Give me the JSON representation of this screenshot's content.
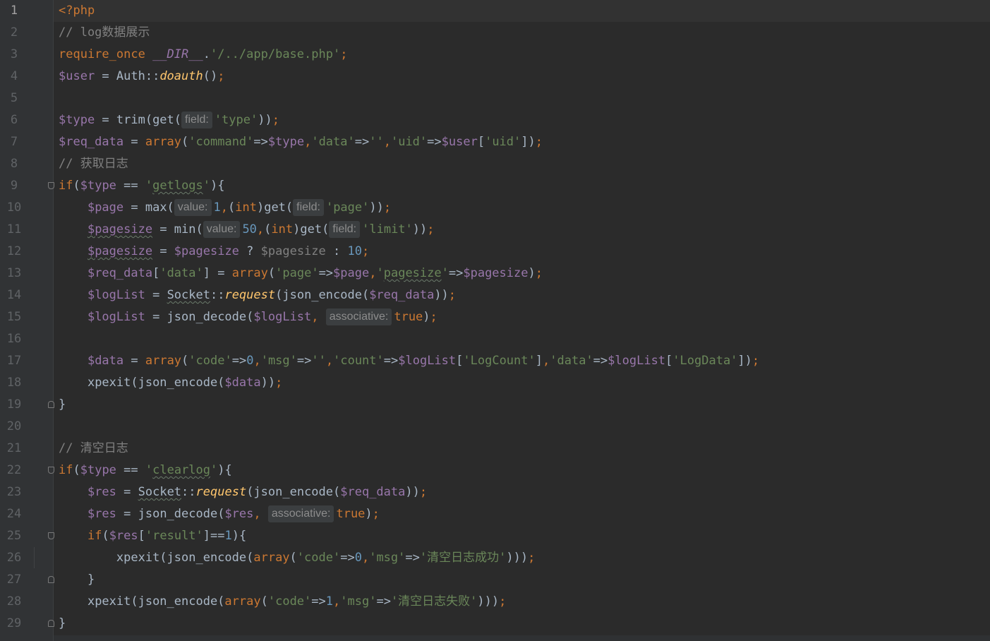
{
  "editor": {
    "current_line": 1,
    "line_numbers": [
      "1",
      "2",
      "3",
      "4",
      "5",
      "6",
      "7",
      "8",
      "9",
      "10",
      "11",
      "12",
      "13",
      "14",
      "15",
      "16",
      "17",
      "18",
      "19",
      "20",
      "21",
      "22",
      "23",
      "24",
      "25",
      "26",
      "27",
      "28",
      "29"
    ],
    "lines": [
      [
        {
          "t": "kw",
          "v": "<?php"
        }
      ],
      [
        {
          "t": "cmt",
          "v": "// log数据展示"
        }
      ],
      [
        {
          "t": "kw",
          "v": "require_once "
        },
        {
          "t": "const",
          "v": "__DIR__"
        },
        {
          "t": "op",
          "v": "."
        },
        {
          "t": "str",
          "v": "'/../app/base.php'"
        },
        {
          "t": "kw",
          "v": ";"
        }
      ],
      [
        {
          "t": "var",
          "v": "$user"
        },
        {
          "t": "op",
          "v": " = Auth::"
        },
        {
          "t": "fn",
          "v": "doauth"
        },
        {
          "t": "op",
          "v": "()"
        },
        {
          "t": "kw",
          "v": ";"
        }
      ],
      [],
      [
        {
          "t": "var",
          "v": "$type"
        },
        {
          "t": "op",
          "v": " = trim(get("
        },
        {
          "t": "hint",
          "v": "field:"
        },
        {
          "t": "str",
          "v": "'type'"
        },
        {
          "t": "op",
          "v": "))"
        },
        {
          "t": "kw",
          "v": ";"
        }
      ],
      [
        {
          "t": "var",
          "v": "$req_data"
        },
        {
          "t": "op",
          "v": " = "
        },
        {
          "t": "kw",
          "v": "array"
        },
        {
          "t": "op",
          "v": "("
        },
        {
          "t": "str",
          "v": "'command'"
        },
        {
          "t": "op",
          "v": "=>"
        },
        {
          "t": "var",
          "v": "$type"
        },
        {
          "t": "kw",
          "v": ","
        },
        {
          "t": "str",
          "v": "'data'"
        },
        {
          "t": "op",
          "v": "=>"
        },
        {
          "t": "str",
          "v": "''"
        },
        {
          "t": "kw",
          "v": ","
        },
        {
          "t": "str",
          "v": "'uid'"
        },
        {
          "t": "op",
          "v": "=>"
        },
        {
          "t": "var",
          "v": "$user"
        },
        {
          "t": "op",
          "v": "["
        },
        {
          "t": "str",
          "v": "'uid'"
        },
        {
          "t": "op",
          "v": "])"
        },
        {
          "t": "kw",
          "v": ";"
        }
      ],
      [
        {
          "t": "cmt",
          "v": "// 获取日志"
        }
      ],
      [
        {
          "t": "kw",
          "v": "if"
        },
        {
          "t": "op",
          "v": "("
        },
        {
          "t": "var",
          "v": "$type"
        },
        {
          "t": "op",
          "v": " == "
        },
        {
          "t": "str",
          "v": "'"
        },
        {
          "t": "strw",
          "v": "getlogs"
        },
        {
          "t": "str",
          "v": "'"
        },
        {
          "t": "op",
          "v": "){"
        }
      ],
      [
        {
          "t": "sp",
          "v": "    "
        },
        {
          "t": "var",
          "v": "$page"
        },
        {
          "t": "op",
          "v": " = max("
        },
        {
          "t": "hint",
          "v": "value:"
        },
        {
          "t": "num",
          "v": "1"
        },
        {
          "t": "kw",
          "v": ","
        },
        {
          "t": "op",
          "v": "("
        },
        {
          "t": "kw",
          "v": "int"
        },
        {
          "t": "op",
          "v": ")get("
        },
        {
          "t": "hint",
          "v": "field:"
        },
        {
          "t": "str",
          "v": "'page'"
        },
        {
          "t": "op",
          "v": "))"
        },
        {
          "t": "kw",
          "v": ";"
        }
      ],
      [
        {
          "t": "sp",
          "v": "    "
        },
        {
          "t": "varw",
          "v": "$pagesize"
        },
        {
          "t": "op",
          "v": " = min("
        },
        {
          "t": "hint",
          "v": "value:"
        },
        {
          "t": "num",
          "v": "50"
        },
        {
          "t": "kw",
          "v": ","
        },
        {
          "t": "op",
          "v": "("
        },
        {
          "t": "kw",
          "v": "int"
        },
        {
          "t": "op",
          "v": ")get("
        },
        {
          "t": "hint",
          "v": "field:"
        },
        {
          "t": "str",
          "v": "'limit'"
        },
        {
          "t": "op",
          "v": "))"
        },
        {
          "t": "kw",
          "v": ";"
        }
      ],
      [
        {
          "t": "sp",
          "v": "    "
        },
        {
          "t": "varw",
          "v": "$pagesize"
        },
        {
          "t": "op",
          "v": " = "
        },
        {
          "t": "var",
          "v": "$pagesize"
        },
        {
          "t": "op",
          "v": " ? "
        },
        {
          "t": "cmt",
          "v": "$pagesize"
        },
        {
          "t": "op",
          "v": " : "
        },
        {
          "t": "num",
          "v": "10"
        },
        {
          "t": "kw",
          "v": ";"
        }
      ],
      [
        {
          "t": "sp",
          "v": "    "
        },
        {
          "t": "var",
          "v": "$req_data"
        },
        {
          "t": "op",
          "v": "["
        },
        {
          "t": "str",
          "v": "'data'"
        },
        {
          "t": "op",
          "v": "] = "
        },
        {
          "t": "kw",
          "v": "array"
        },
        {
          "t": "op",
          "v": "("
        },
        {
          "t": "str",
          "v": "'page'"
        },
        {
          "t": "op",
          "v": "=>"
        },
        {
          "t": "var",
          "v": "$page"
        },
        {
          "t": "kw",
          "v": ","
        },
        {
          "t": "str",
          "v": "'"
        },
        {
          "t": "strw",
          "v": "pagesize"
        },
        {
          "t": "str",
          "v": "'"
        },
        {
          "t": "op",
          "v": "=>"
        },
        {
          "t": "var",
          "v": "$pagesize"
        },
        {
          "t": "op",
          "v": ")"
        },
        {
          "t": "kw",
          "v": ";"
        }
      ],
      [
        {
          "t": "sp",
          "v": "    "
        },
        {
          "t": "var",
          "v": "$logList"
        },
        {
          "t": "op",
          "v": " = "
        },
        {
          "t": "opw",
          "v": "Socket"
        },
        {
          "t": "op",
          "v": "::"
        },
        {
          "t": "fn",
          "v": "request"
        },
        {
          "t": "op",
          "v": "(json_encode("
        },
        {
          "t": "var",
          "v": "$req_data"
        },
        {
          "t": "op",
          "v": "))"
        },
        {
          "t": "kw",
          "v": ";"
        }
      ],
      [
        {
          "t": "sp",
          "v": "    "
        },
        {
          "t": "var",
          "v": "$logList"
        },
        {
          "t": "op",
          "v": " = json_decode("
        },
        {
          "t": "var",
          "v": "$logList"
        },
        {
          "t": "kw",
          "v": ", "
        },
        {
          "t": "hint",
          "v": "associative:"
        },
        {
          "t": "kw",
          "v": "true"
        },
        {
          "t": "op",
          "v": ")"
        },
        {
          "t": "kw",
          "v": ";"
        }
      ],
      [],
      [
        {
          "t": "sp",
          "v": "    "
        },
        {
          "t": "var",
          "v": "$data"
        },
        {
          "t": "op",
          "v": " = "
        },
        {
          "t": "kw",
          "v": "array"
        },
        {
          "t": "op",
          "v": "("
        },
        {
          "t": "str",
          "v": "'code'"
        },
        {
          "t": "op",
          "v": "=>"
        },
        {
          "t": "num",
          "v": "0"
        },
        {
          "t": "kw",
          "v": ","
        },
        {
          "t": "str",
          "v": "'msg'"
        },
        {
          "t": "op",
          "v": "=>"
        },
        {
          "t": "str",
          "v": "''"
        },
        {
          "t": "kw",
          "v": ","
        },
        {
          "t": "str",
          "v": "'count'"
        },
        {
          "t": "op",
          "v": "=>"
        },
        {
          "t": "var",
          "v": "$logList"
        },
        {
          "t": "op",
          "v": "["
        },
        {
          "t": "str",
          "v": "'LogCount'"
        },
        {
          "t": "op",
          "v": "]"
        },
        {
          "t": "kw",
          "v": ","
        },
        {
          "t": "str",
          "v": "'data'"
        },
        {
          "t": "op",
          "v": "=>"
        },
        {
          "t": "var",
          "v": "$logList"
        },
        {
          "t": "op",
          "v": "["
        },
        {
          "t": "str",
          "v": "'LogData'"
        },
        {
          "t": "op",
          "v": "])"
        },
        {
          "t": "kw",
          "v": ";"
        }
      ],
      [
        {
          "t": "sp",
          "v": "    "
        },
        {
          "t": "op",
          "v": "xpexit(json_encode("
        },
        {
          "t": "var",
          "v": "$data"
        },
        {
          "t": "op",
          "v": "))"
        },
        {
          "t": "kw",
          "v": ";"
        }
      ],
      [
        {
          "t": "op",
          "v": "}"
        }
      ],
      [],
      [
        {
          "t": "cmt",
          "v": "// 清空日志"
        }
      ],
      [
        {
          "t": "kw",
          "v": "if"
        },
        {
          "t": "op",
          "v": "("
        },
        {
          "t": "var",
          "v": "$type"
        },
        {
          "t": "op",
          "v": " == "
        },
        {
          "t": "str",
          "v": "'"
        },
        {
          "t": "strw",
          "v": "clearlog"
        },
        {
          "t": "str",
          "v": "'"
        },
        {
          "t": "op",
          "v": "){"
        }
      ],
      [
        {
          "t": "sp",
          "v": "    "
        },
        {
          "t": "var",
          "v": "$res"
        },
        {
          "t": "op",
          "v": " = "
        },
        {
          "t": "opw",
          "v": "Socket"
        },
        {
          "t": "op",
          "v": "::"
        },
        {
          "t": "fn",
          "v": "request"
        },
        {
          "t": "op",
          "v": "(json_encode("
        },
        {
          "t": "var",
          "v": "$req_data"
        },
        {
          "t": "op",
          "v": "))"
        },
        {
          "t": "kw",
          "v": ";"
        }
      ],
      [
        {
          "t": "sp",
          "v": "    "
        },
        {
          "t": "var",
          "v": "$res"
        },
        {
          "t": "op",
          "v": " = json_decode("
        },
        {
          "t": "var",
          "v": "$res"
        },
        {
          "t": "kw",
          "v": ", "
        },
        {
          "t": "hint",
          "v": "associative:"
        },
        {
          "t": "kw",
          "v": "true"
        },
        {
          "t": "op",
          "v": ")"
        },
        {
          "t": "kw",
          "v": ";"
        }
      ],
      [
        {
          "t": "sp",
          "v": "    "
        },
        {
          "t": "kw",
          "v": "if"
        },
        {
          "t": "op",
          "v": "("
        },
        {
          "t": "var",
          "v": "$res"
        },
        {
          "t": "op",
          "v": "["
        },
        {
          "t": "str",
          "v": "'result'"
        },
        {
          "t": "op",
          "v": "]=="
        },
        {
          "t": "num",
          "v": "1"
        },
        {
          "t": "op",
          "v": "){"
        }
      ],
      [
        {
          "t": "sp",
          "v": "        "
        },
        {
          "t": "op",
          "v": "xpexit(json_encode("
        },
        {
          "t": "kw",
          "v": "array"
        },
        {
          "t": "op",
          "v": "("
        },
        {
          "t": "str",
          "v": "'code'"
        },
        {
          "t": "op",
          "v": "=>"
        },
        {
          "t": "num",
          "v": "0"
        },
        {
          "t": "kw",
          "v": ","
        },
        {
          "t": "str",
          "v": "'msg'"
        },
        {
          "t": "op",
          "v": "=>"
        },
        {
          "t": "str",
          "v": "'清空日志成功'"
        },
        {
          "t": "op",
          "v": ")))"
        },
        {
          "t": "kw",
          "v": ";"
        }
      ],
      [
        {
          "t": "sp",
          "v": "    "
        },
        {
          "t": "op",
          "v": "}"
        }
      ],
      [
        {
          "t": "sp",
          "v": "    "
        },
        {
          "t": "op",
          "v": "xpexit(json_encode("
        },
        {
          "t": "kw",
          "v": "array"
        },
        {
          "t": "op",
          "v": "("
        },
        {
          "t": "str",
          "v": "'code'"
        },
        {
          "t": "op",
          "v": "=>"
        },
        {
          "t": "num",
          "v": "1"
        },
        {
          "t": "kw",
          "v": ","
        },
        {
          "t": "str",
          "v": "'msg'"
        },
        {
          "t": "op",
          "v": "=>"
        },
        {
          "t": "str",
          "v": "'清空日志失败'"
        },
        {
          "t": "op",
          "v": ")))"
        },
        {
          "t": "kw",
          "v": ";"
        }
      ],
      [
        {
          "t": "op",
          "v": "}"
        }
      ]
    ],
    "fold_markers": [
      {
        "line": 9,
        "kind": "open"
      },
      {
        "line": 19,
        "kind": "close"
      },
      {
        "line": 22,
        "kind": "open"
      },
      {
        "line": 25,
        "kind": "open"
      },
      {
        "line": 27,
        "kind": "close"
      },
      {
        "line": 29,
        "kind": "close"
      }
    ]
  }
}
